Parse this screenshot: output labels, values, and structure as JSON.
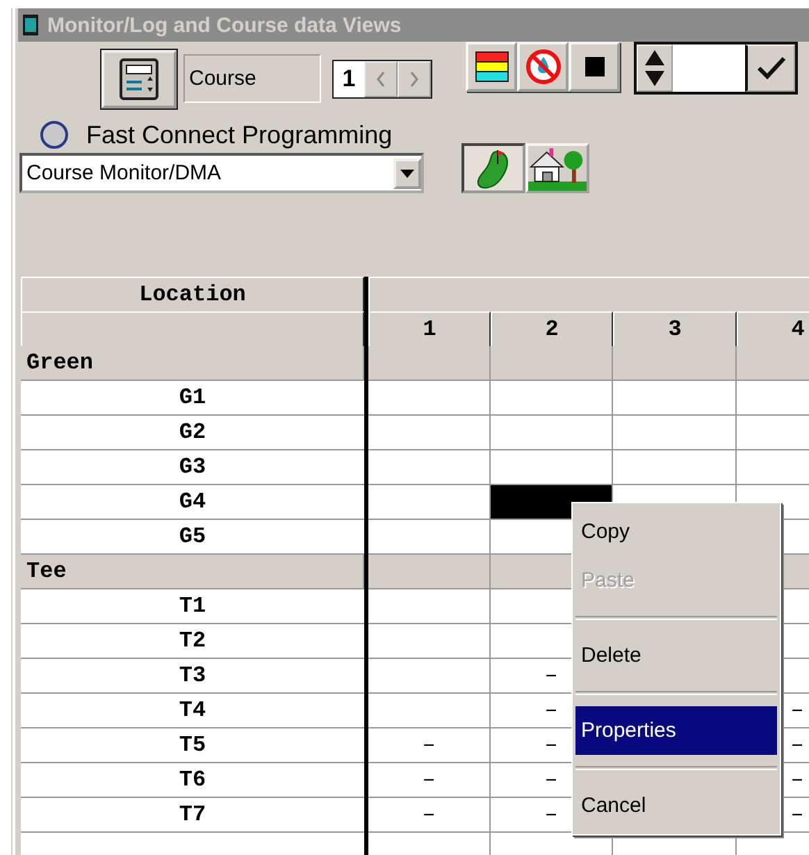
{
  "window": {
    "title": "Monitor/Log and Course data Views"
  },
  "toolbar": {
    "view_field": {
      "value": "Course"
    },
    "page_spinner": {
      "value": "1"
    },
    "view_buttons": [
      {
        "kind": "course",
        "selected": true
      },
      {
        "kind": "house",
        "selected": false
      }
    ],
    "fast_connect": {
      "label": "Fast Connect Programming",
      "selected": false
    },
    "mode_dropdown": {
      "value": "Course Monitor/DMA"
    }
  },
  "grid": {
    "header": "Location",
    "columns": [
      "1",
      "2",
      "3",
      "4"
    ],
    "sections": [
      {
        "name": "Green",
        "rows": [
          {
            "label": "G1",
            "cells": [
              {
                "selected": false
              },
              {
                "selected": false
              },
              {
                "selected": false
              },
              {
                "selected": false
              }
            ]
          },
          {
            "label": "G2",
            "cells": [
              {
                "selected": false
              },
              {
                "selected": false
              },
              {
                "selected": false
              },
              {
                "selected": false
              }
            ]
          },
          {
            "label": "G3",
            "cells": [
              {
                "selected": false
              },
              {
                "selected": false
              },
              {
                "selected": false
              },
              {
                "selected": false
              }
            ]
          },
          {
            "label": "G4",
            "cells": [
              {
                "selected": false
              },
              {
                "selected": true
              },
              {
                "selected": false
              },
              {
                "selected": false
              }
            ]
          },
          {
            "label": "G5",
            "cells": [
              {
                "selected": false
              },
              {
                "selected": false
              },
              null,
              {
                "selected": false
              }
            ]
          }
        ]
      },
      {
        "name": "Tee",
        "rows": [
          {
            "label": "T1",
            "cells": [
              {
                "selected": false
              },
              {
                "selected": false
              },
              null,
              {
                "selected": false
              }
            ]
          },
          {
            "label": "T2",
            "cells": [
              {
                "selected": false
              },
              {
                "selected": false
              },
              null,
              {
                "selected": false
              }
            ]
          },
          {
            "label": "T3",
            "cells": [
              {
                "selected": false
              },
              {
                "text": "–",
                "selected": false
              },
              null,
              {
                "selected": false
              }
            ]
          },
          {
            "label": "T4",
            "cells": [
              {
                "selected": false
              },
              {
                "text": "–",
                "selected": false
              },
              null,
              {
                "text": "–",
                "selected": false
              }
            ]
          },
          {
            "label": "T5",
            "cells": [
              {
                "text": "–",
                "selected": false
              },
              {
                "text": "–",
                "selected": false
              },
              null,
              {
                "text": "–",
                "selected": false
              }
            ]
          },
          {
            "label": "T6",
            "cells": [
              {
                "text": "–",
                "selected": false
              },
              {
                "text": "–",
                "selected": false
              },
              null,
              {
                "text": "–",
                "selected": false
              }
            ]
          },
          {
            "label": "T7",
            "cells": [
              {
                "text": "–",
                "selected": false
              },
              {
                "text": "–",
                "selected": false
              },
              null,
              {
                "text": "–",
                "selected": false
              }
            ]
          }
        ]
      }
    ]
  },
  "context_menu": [
    {
      "kind": "item",
      "label": "Copy",
      "disabled": false,
      "selected": false
    },
    {
      "kind": "item",
      "label": "Paste",
      "disabled": true,
      "selected": false
    },
    {
      "kind": "separator"
    },
    {
      "kind": "item",
      "label": "Delete",
      "disabled": false,
      "selected": false
    },
    {
      "kind": "separator"
    },
    {
      "kind": "item",
      "label": "Properties",
      "disabled": false,
      "selected": true
    },
    {
      "kind": "separator"
    },
    {
      "kind": "item",
      "label": "Cancel",
      "disabled": false,
      "selected": false
    }
  ]
}
